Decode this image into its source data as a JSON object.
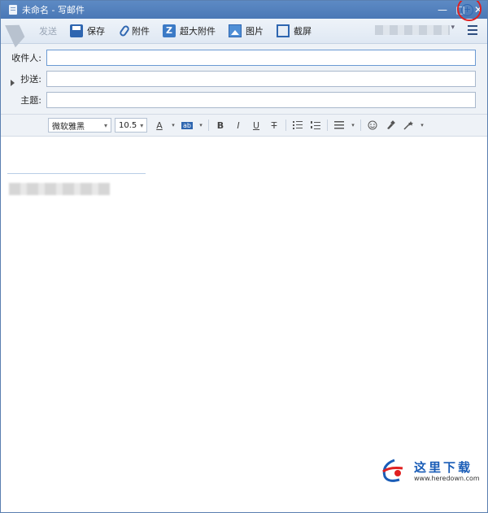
{
  "window": {
    "title": "未命名 - 写邮件",
    "controls": {
      "minimize": "—",
      "maximize": "□",
      "close": "✕"
    }
  },
  "toolbar": {
    "send_label": "发送",
    "save_label": "保存",
    "attach_label": "附件",
    "large_attach_label": "超大附件",
    "image_label": "图片",
    "screenshot_label": "截屏",
    "large_attach_icon_letter": "Z"
  },
  "header": {
    "to_label": "收件人:",
    "to_value": "",
    "cc_label": "抄送:",
    "cc_value": "",
    "subject_label": "主题:",
    "subject_value": "",
    "add_contact_symbol": "+"
  },
  "format_toolbar": {
    "font_family": "微软雅黑",
    "font_size": "10.5",
    "font_color_symbol": "A",
    "highlight_symbol": "ab",
    "bold": "B",
    "italic": "I",
    "underline": "U",
    "strike": "T",
    "chevron": "▾"
  },
  "watermark": {
    "text": "这里下载",
    "url": "www.heredown.com"
  },
  "colors": {
    "titlebar": "#4a78b6",
    "accent": "#2e66b0",
    "highlight_ring": "#e02020"
  }
}
